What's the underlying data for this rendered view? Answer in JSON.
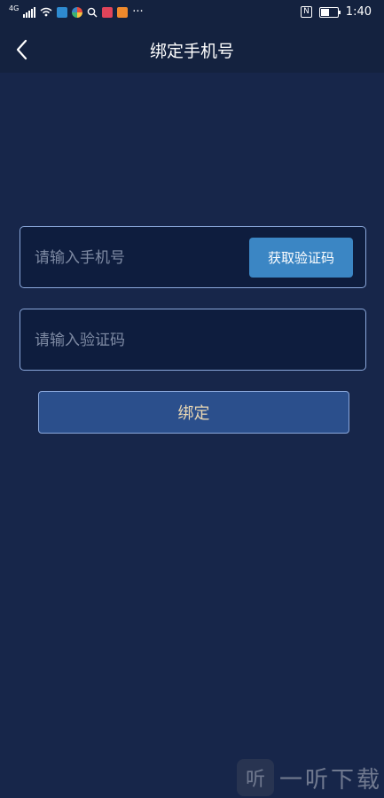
{
  "status_bar": {
    "network": "4G",
    "more": "···",
    "time": "1:40",
    "nfc": "N"
  },
  "header": {
    "title": "绑定手机号"
  },
  "form": {
    "phone_placeholder": "请输入手机号",
    "code_placeholder": "请输入验证码",
    "get_code_label": "获取验证码",
    "bind_label": "绑定"
  },
  "watermark": {
    "logo_glyph": "听",
    "text": "一听下载"
  },
  "icons": [
    "signal-icon",
    "wifi-icon",
    "search-icon",
    "nfc-icon",
    "battery-icon",
    "back-icon"
  ],
  "colors": {
    "background": "#17264a",
    "bar": "#14223f",
    "field_bg": "#0e1d3e",
    "border": "#8aa7da",
    "code_button": "#3b86c4",
    "bind_button": "#2b4f8c",
    "bind_text": "#e9d7b3"
  }
}
